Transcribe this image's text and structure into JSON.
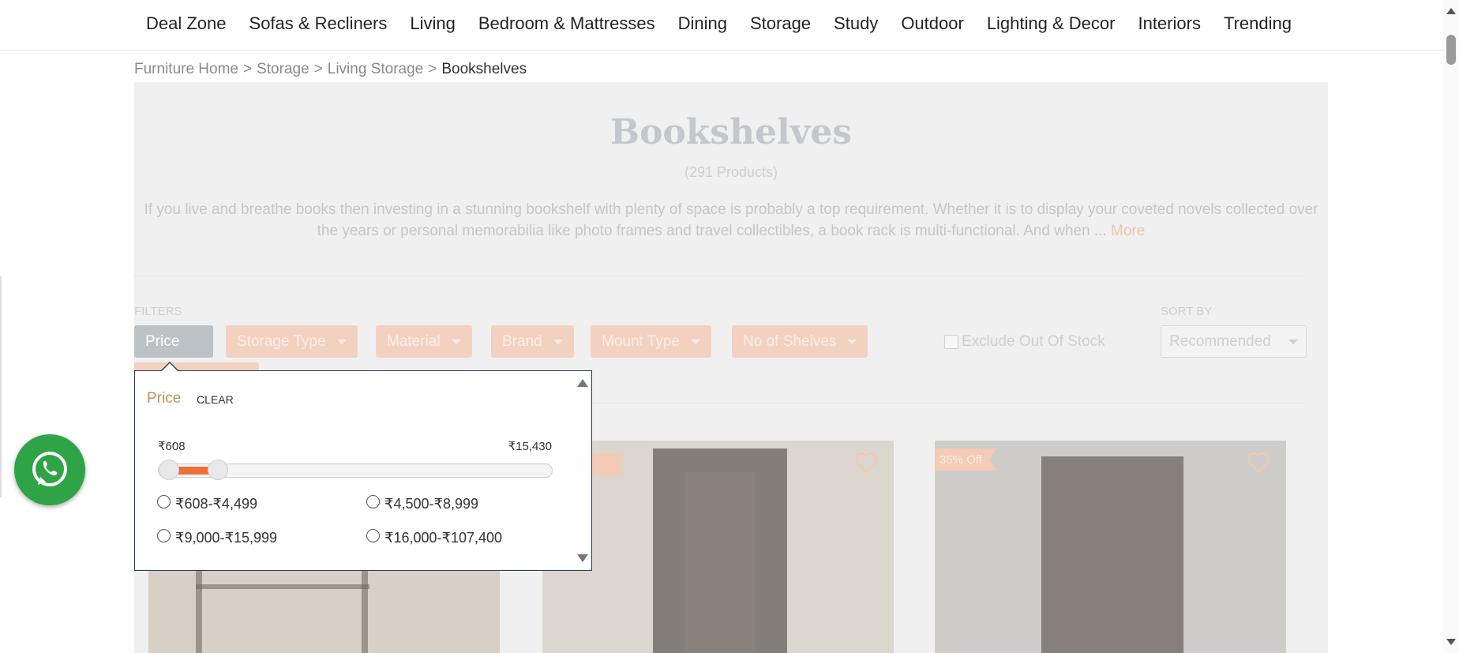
{
  "nav": {
    "items": [
      "Deal Zone",
      "Sofas & Recliners",
      "Living",
      "Bedroom & Mattresses",
      "Dining",
      "Storage",
      "Study",
      "Outdoor",
      "Lighting & Decor",
      "Interiors",
      "Trending"
    ]
  },
  "breadcrumb": {
    "items": [
      "Furniture Home",
      "Storage",
      "Living Storage"
    ],
    "separator": ">",
    "current": "Bookshelves"
  },
  "page": {
    "title": "Bookshelves",
    "count": "(291 Products)",
    "description": "If you live and breathe books then investing in a stunning bookshelf with plenty of space is probably a top requirement. Whether it is to display your coveted novels collected over the years or personal memorabilia like photo frames and travel collectibles, a book rack is multi-functional. And when ...",
    "more_label": "More"
  },
  "filters": {
    "label": "FILTERS",
    "chips": [
      "Price",
      "Storage Type",
      "Material",
      "Brand",
      "Mount Type",
      "No of Shelves"
    ],
    "exclude_label": "Exclude Out Of Stock",
    "exclude_checked": false
  },
  "sort": {
    "label": "SORT BY",
    "selected": "Recommended"
  },
  "price_popup": {
    "title": "Price",
    "clear_label": "CLEAR",
    "range_min_label": "₹608",
    "range_max_label": "₹15,430",
    "slider_low_fraction": 0.0,
    "slider_high_fraction": 0.13,
    "options": [
      "₹608-₹4,499",
      "₹4,500-₹8,999",
      "₹9,000-₹15,999",
      "₹16,000-₹107,400"
    ]
  },
  "products": {
    "badge_label": "35% Off"
  },
  "colors": {
    "accent_orange": "#ef6f3b",
    "price_title": "#c38f5e",
    "whatsapp_green": "#2ea446"
  },
  "icons": [
    "whatsapp-icon",
    "heart-icon",
    "chevron-down-icon",
    "scroll-up-icon",
    "scroll-down-icon"
  ]
}
